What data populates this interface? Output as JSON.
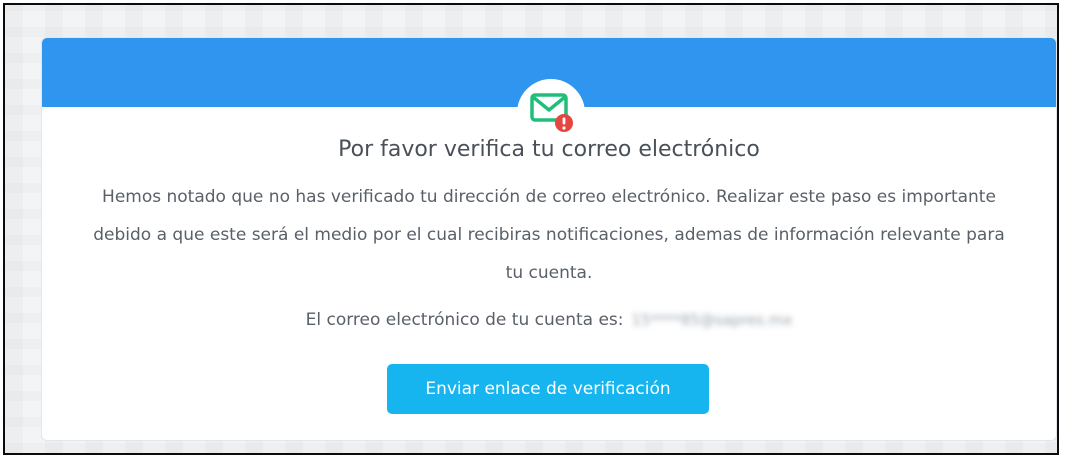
{
  "card": {
    "title": "Por favor verifica tu correo electrónico",
    "description": "Hemos notado que no has verificado tu dirección de correo electrónico. Realizar este paso es importante debido a que este será el medio por el cual recibiras notificaciones, ademas de información relevante para tu cuenta.",
    "email_label": "El correo electrónico de tu cuenta es:",
    "email_value": "15****85@sapres.mx",
    "button_label": "Enviar enlace de verificación",
    "icon": "mail-alert-icon"
  },
  "colors": {
    "header": "#2f95ee",
    "button": "#16b5ef",
    "icon_green": "#1fbf7a",
    "alert_red": "#e5463f"
  }
}
